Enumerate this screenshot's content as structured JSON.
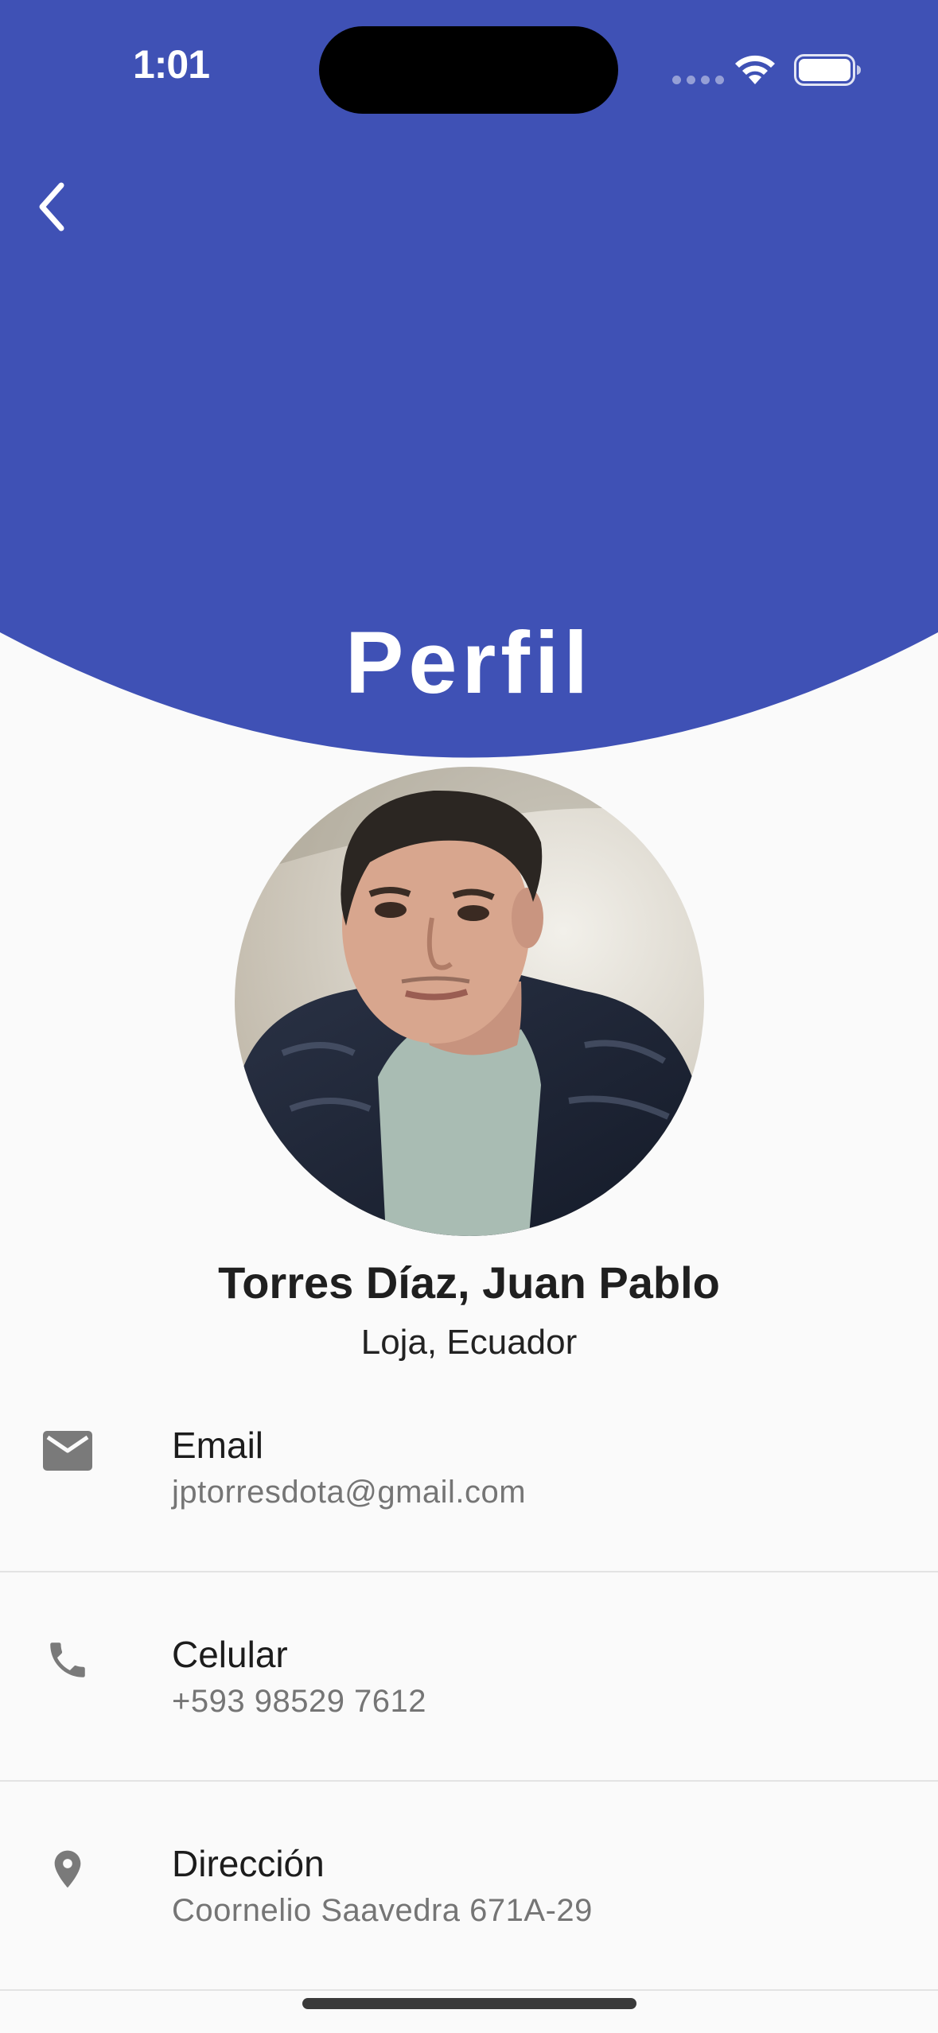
{
  "status_bar": {
    "time": "1:01"
  },
  "header": {
    "title": "Perfil",
    "back_icon": "chevron-left-icon",
    "color": "#3f51b5"
  },
  "profile": {
    "name": "Torres Díaz, Juan Pablo",
    "location": "Loja, Ecuador"
  },
  "info_items": [
    {
      "icon": "email-icon",
      "label": "Email",
      "value": "jptorresdota@gmail.com"
    },
    {
      "icon": "phone-icon",
      "label": "Celular",
      "value": "+593 98529 7612"
    },
    {
      "icon": "location-pin-icon",
      "label": "Dirección",
      "value": "Coornelio Saavedra 671A-29"
    }
  ],
  "colors": {
    "primary": "#3f51b5",
    "background": "#fafafa",
    "icon_gray": "#7a7a7a",
    "secondary_text": "#757575"
  }
}
